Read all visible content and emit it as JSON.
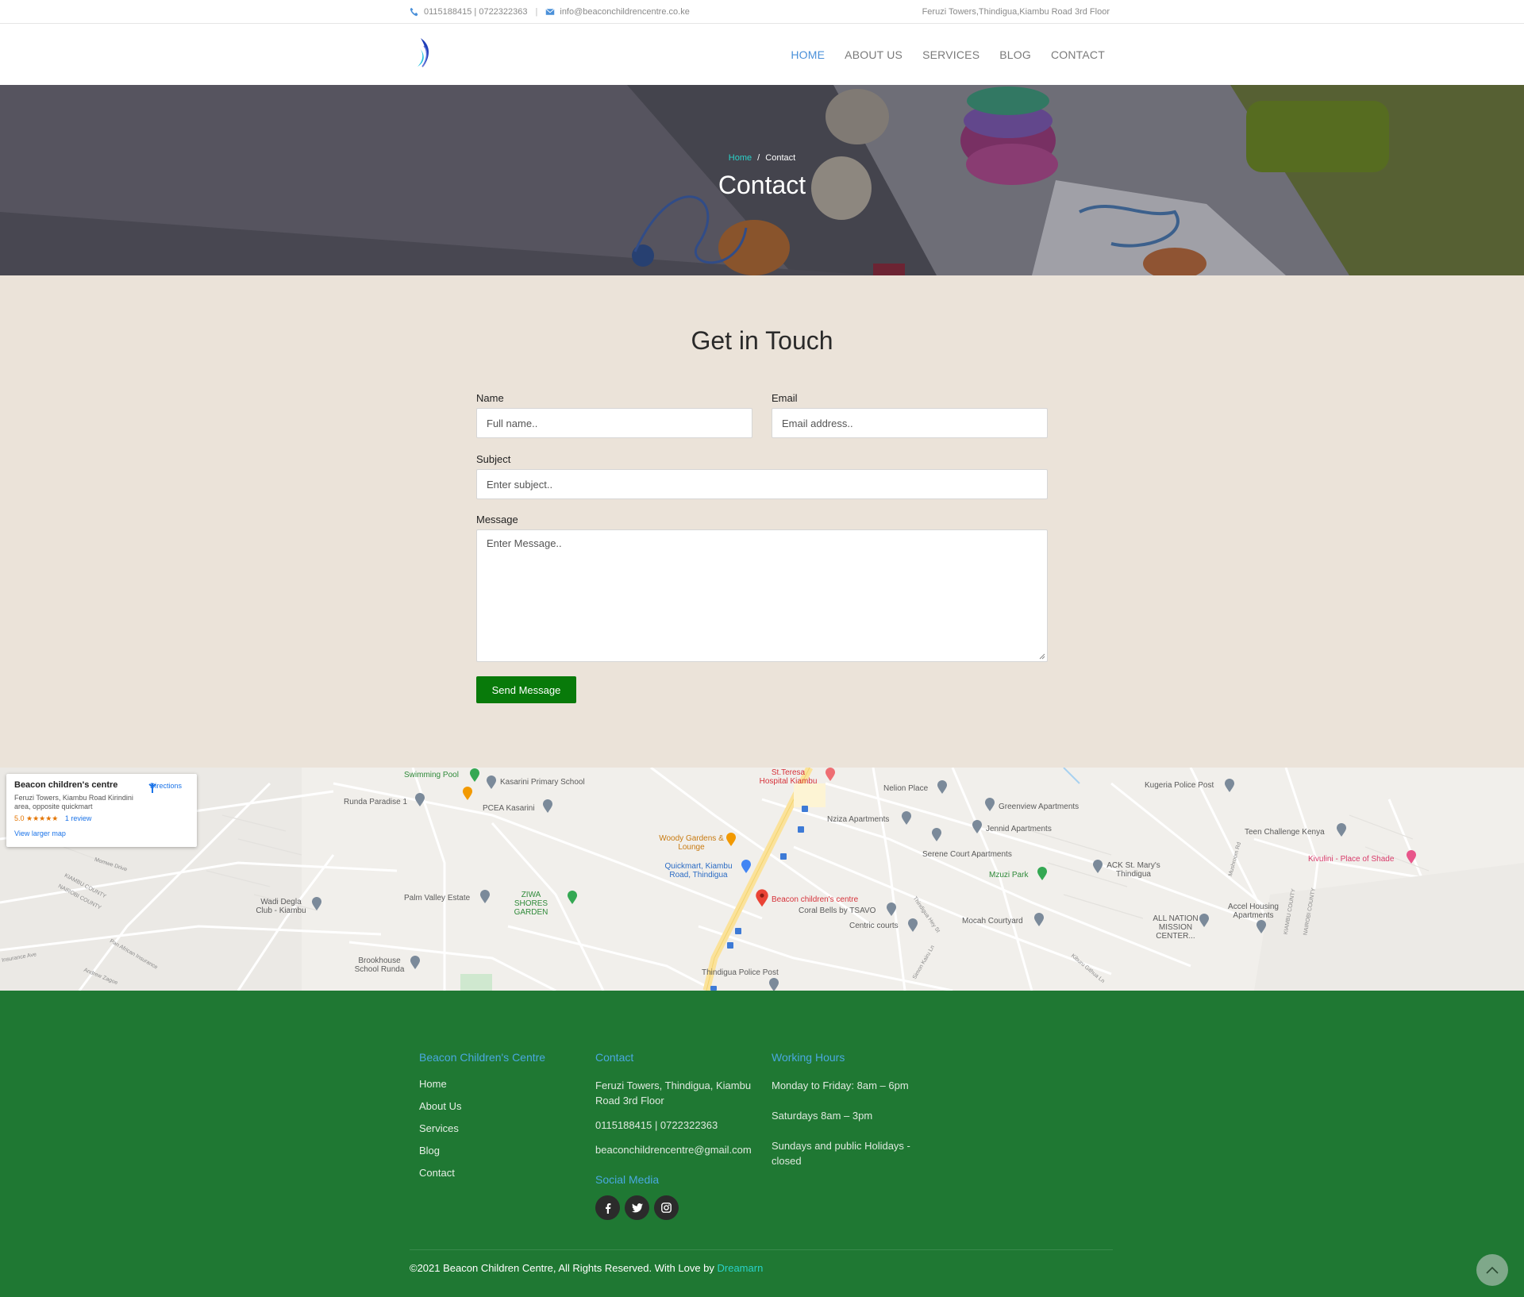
{
  "topbar": {
    "phone": "0115188415 | 0722322363",
    "email": "info@beaconchildrencentre.co.ke",
    "address": "Feruzi Towers,Thindigua,Kiambu Road 3rd Floor"
  },
  "nav": {
    "items": [
      "HOME",
      "ABOUT US",
      "SERVICES",
      "BLOG",
      "CONTACT"
    ],
    "active": "HOME"
  },
  "hero": {
    "breadcrumb_home": "Home",
    "breadcrumb_sep": "/",
    "breadcrumb_current": "Contact",
    "title": "Contact"
  },
  "contact_form": {
    "heading": "Get in Touch",
    "name_label": "Name",
    "name_placeholder": "Full name..",
    "email_label": "Email",
    "email_placeholder": "Email address..",
    "subject_label": "Subject",
    "subject_placeholder": "Enter subject..",
    "message_label": "Message",
    "message_placeholder": "Enter Message..",
    "submit_label": "Send Message",
    "submit_color": "#087a0a"
  },
  "map": {
    "card_title": "Beacon children's centre",
    "card_address": "Feruzi Towers, Kiambu Road Kirindini area, opposite quickmart",
    "card_rating": "5.0 ★★★★★",
    "card_reviews": "1 review",
    "card_directions": "Directions",
    "card_view_larger": "View larger map",
    "places": {
      "swimming_pool": "Swimming Pool",
      "kasarini_school": "Kasarini Primary School",
      "st_teresa": "St.Teresa Hospital Kiambu",
      "nelion": "Nelion Place",
      "kugeria": "Kugeria Police Post",
      "runda_paradise": "Runda Paradise 1",
      "pcea": "PCEA Kasarini",
      "nziza": "Nziza Apartments",
      "greenview": "Greenview Apartments",
      "jennid": "Jennid Apartments",
      "teen_challenge": "Teen Challenge Kenya",
      "woody": "Woody Gardens & Lounge",
      "serene": "Serene Court Apartments",
      "kivulini": "Kivulini - Place of Shade",
      "quickmart": "Quickmart, Kiambu Road, Thindigua",
      "ack": "ACK St. Mary's Thindigua",
      "mzuzi": "Mzuzi Park",
      "wadi": "Wadi Degla Club - Kiambu",
      "palm": "Palm Valley Estate",
      "ziwa": "ZIWA SHORES GARDEN",
      "beacon": "Beacon children's centre",
      "coral": "Coral Bells by TSAVO",
      "mocah": "Mocah Courtyard",
      "accel": "Accel Housing Apartments",
      "all_nation": "ALL NATION MISSION CENTER...",
      "centric": "Centric courts",
      "brookhouse": "Brookhouse School Runda",
      "thindigua_police": "Thindigua Police Post",
      "kiambu_county_1": "KIAMBU COUNTY",
      "nairobi_county_1": "NAIROBI COUNTY",
      "kiambu_county_2": "KIAMBU COUNTY",
      "nairobi_county_2": "NAIROBI COUNTY",
      "road_momwe": "Momwe Drive",
      "road_insurance": "Insurance Ave",
      "road_pan_african": "Pan African Insurance",
      "road_andrew": "Andrew Zagoe",
      "road_thindigua_hey": "Thindigua Hey St",
      "road_simon": "Simon Kairu Ln",
      "road_kiburu": "Kiburu Githua Ln",
      "road_mushroom": "Mushroom Rd"
    }
  },
  "footer": {
    "col1_title": "Beacon Children's Centre",
    "col1_links": [
      "Home",
      "About Us",
      "Services",
      "Blog",
      "Contact"
    ],
    "col2_title": "Contact",
    "col2_address": "Feruzi Towers, Thindigua, Kiambu Road 3rd Floor",
    "col2_phone": "0115188415 | 0722322363",
    "col2_email": "beaconchildrencentre@gmail.com",
    "social_title": "Social Media",
    "social_icons": [
      "facebook-icon",
      "twitter-icon",
      "instagram-icon"
    ],
    "col3_title": "Working Hours",
    "hours": [
      "Monday to Friday: 8am – 6pm",
      "Saturdays 8am – 3pm",
      "Sundays and public Holidays - closed"
    ],
    "copyright": "©2021 Beacon Children Centre, All Rights Reserved. With Love by ",
    "credit": "Dreamarn",
    "bg_color": "#1f7833",
    "title_color": "#4aa8e0"
  }
}
